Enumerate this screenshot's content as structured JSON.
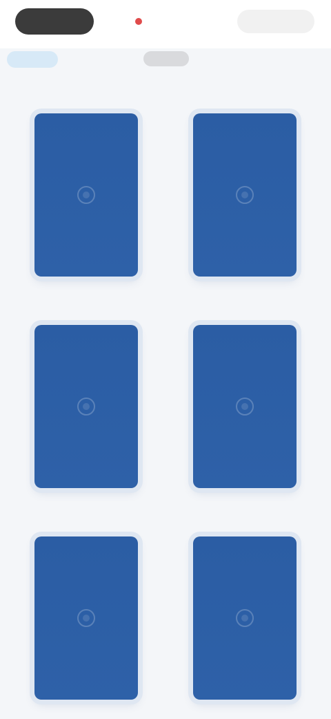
{
  "header": {
    "pill_button_label": "",
    "center_label": "",
    "right_label": "",
    "accent_link_label": "",
    "subtitle": ""
  },
  "colors": {
    "card_back": "#2b5da4",
    "page_background": "#f4f6f9",
    "pill_button": "#3b3b3b",
    "accent": "#4a90c8",
    "status_dot": "#e04b4b"
  },
  "cards": {
    "count": 6,
    "face_down": true
  }
}
